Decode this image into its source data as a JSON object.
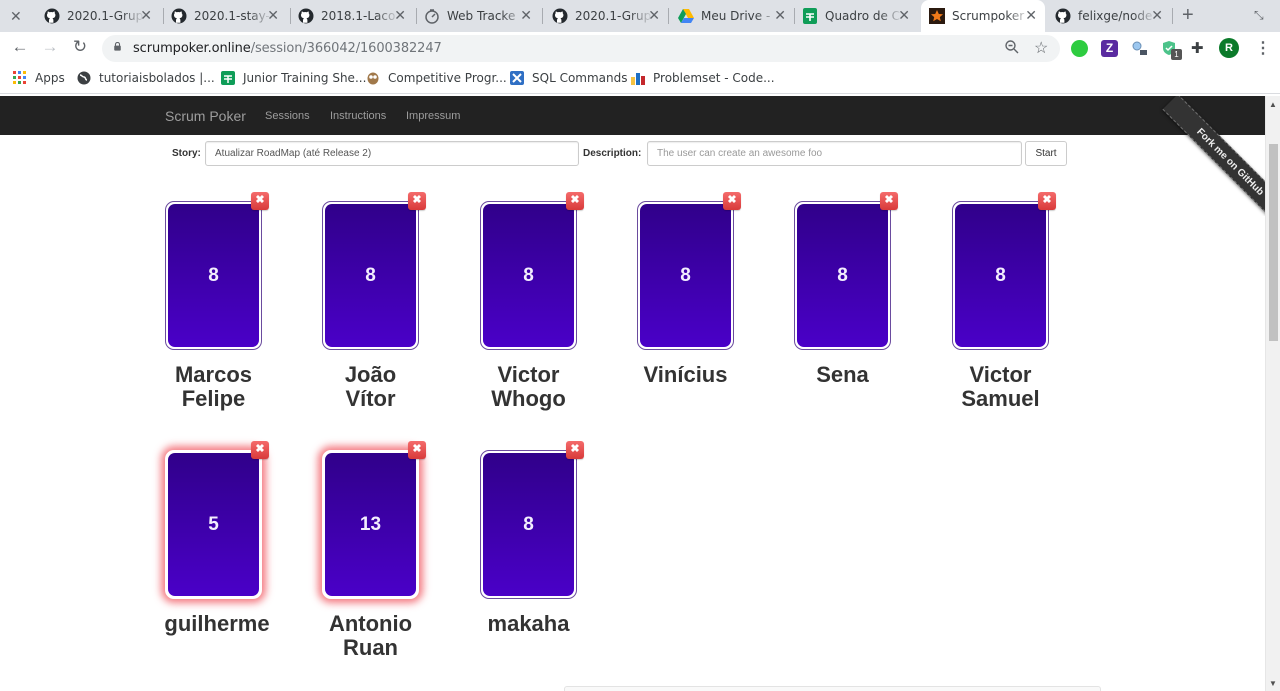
{
  "browser": {
    "tabs": [
      {
        "title": "2020.1-Grup",
        "icon": "github-icon",
        "active": false
      },
      {
        "title": "2020.1-stay-",
        "icon": "github-icon",
        "active": false
      },
      {
        "title": "2018.1-Laco",
        "icon": "github-icon",
        "active": false
      },
      {
        "title": "Web Tracke",
        "icon": "stopwatch-icon",
        "active": false
      },
      {
        "title": "2020.1-Grup",
        "icon": "github-icon",
        "active": false
      },
      {
        "title": "Meu Drive - ",
        "icon": "google-drive-icon",
        "active": false
      },
      {
        "title": "Quadro de C",
        "icon": "google-sheets-icon",
        "active": false
      },
      {
        "title": "Scrumpoker",
        "icon": "scrumpoker-star-icon",
        "active": true
      },
      {
        "title": "felixge/node",
        "icon": "github-icon",
        "active": false
      }
    ],
    "url_host": "scrumpoker.online",
    "url_path": "/session/366042/1600382247",
    "extension_badge": "1",
    "profile_initial": "R",
    "bookmarks": [
      {
        "label": "Apps",
        "icon": "apps-grid-icon"
      },
      {
        "label": "tutoriaisbolados |...",
        "icon": "globe-icon"
      },
      {
        "label": "Junior Training She...",
        "icon": "google-sheets-icon"
      },
      {
        "label": "Competitive Progr...",
        "icon": "owl-icon"
      },
      {
        "label": "SQL Commands",
        "icon": "sql-icon"
      },
      {
        "label": "Problemset - Code...",
        "icon": "codeforces-icon"
      }
    ]
  },
  "navbar": {
    "brand": "Scrum Poker",
    "links": [
      "Sessions",
      "Instructions",
      "Impressum"
    ]
  },
  "story_form": {
    "story_label": "Story:",
    "story_value": "Atualizar RoadMap (até Release 2)",
    "description_label": "Description:",
    "description_placeholder": "The user can create an awesome foo",
    "start_label": "Start"
  },
  "ribbon": "Fork me on GitHub",
  "colors": {
    "card_top": "#30008a",
    "card_bottom": "#4a00c8",
    "remove_red": "#e04545",
    "glow": "#f0505a",
    "navbar_bg": "#222222"
  },
  "participants": [
    {
      "name": "Marcos Felipe",
      "vote": "8",
      "outlier": false
    },
    {
      "name": "João Vítor",
      "vote": "8",
      "outlier": false
    },
    {
      "name": "Victor Whogo",
      "vote": "8",
      "outlier": false
    },
    {
      "name": "Vinícius",
      "vote": "8",
      "outlier": false
    },
    {
      "name": "Sena",
      "vote": "8",
      "outlier": false
    },
    {
      "name": "Victor Samuel",
      "vote": "8",
      "outlier": false
    },
    {
      "name": "guilherme",
      "vote": "5",
      "outlier": true
    },
    {
      "name": "Antonio Ruan",
      "vote": "13",
      "outlier": true
    },
    {
      "name": "makaha",
      "vote": "8",
      "outlier": false
    }
  ],
  "remove_glyph": "✖"
}
